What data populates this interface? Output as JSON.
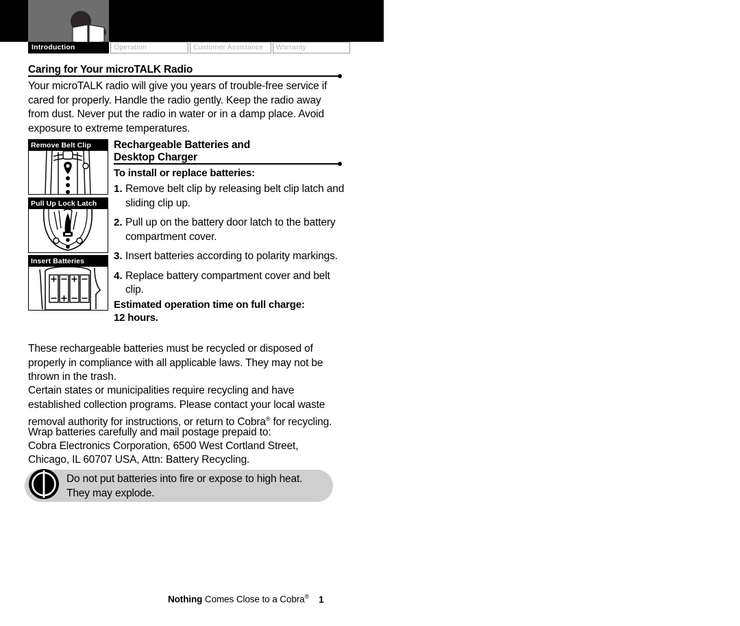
{
  "header": {
    "logo_name": "cobra-open-book-logo",
    "band_color": "#000000",
    "panel_color": "#6e6e6e"
  },
  "tabs": [
    {
      "label": "Introduction",
      "active": true
    },
    {
      "label": "Operation",
      "active": false
    },
    {
      "label": "Customer Assistance",
      "active": false
    },
    {
      "label": "Warranty",
      "active": false
    }
  ],
  "sections": {
    "caring": {
      "heading": "Caring for Your microTALK Radio",
      "paragraph": "Your microTALK radio will give you years of trouble-free service if cared for properly. Handle the radio gently. Keep the radio away from dust. Never put the radio in water or in a damp place. Avoid exposure to extreme temperatures."
    },
    "rechargeable": {
      "heading_line1": "Rechargeable Batteries and",
      "heading_line2": "Desktop Charger",
      "subheading": "To install or replace batteries:",
      "steps": [
        {
          "num": "1.",
          "text": "Remove belt clip by releasing belt clip latch and sliding clip up."
        },
        {
          "num": "2.",
          "text": "Pull up on the battery door latch to the battery compartment cover."
        },
        {
          "num": "3.",
          "text": "Insert batteries according to polarity markings."
        },
        {
          "num": "4.",
          "text": "Replace battery compartment cover and belt clip."
        }
      ],
      "estimate_line1": "Estimated operation time on full charge:",
      "estimate_line2": "12 hours."
    },
    "recycling": {
      "paragraph1": "These rechargeable batteries must be recycled or disposed of properly in compliance with all applicable laws. They may not be thrown in the trash.",
      "paragraph2_pre": "Certain states or municipalities require recycling and have established collection programs. Please contact your local waste removal authority for instructions, or return to Cobra",
      "paragraph2_mark": "®",
      "paragraph2_post": " for recycling.",
      "address_line1": "Wrap batteries carefully and mail postage prepaid to:",
      "address_line2": "Cobra Electronics Corporation, 6500 West Cortland Street,",
      "address_line3": "Chicago, IL 60707 USA, Attn: Battery Recycling."
    },
    "warning": {
      "icon_name": "do-not-burn-icon",
      "line1": "Do not put batteries into fire or expose to high heat.",
      "line2": "They may explode.",
      "background": "#cfcfcf"
    }
  },
  "figures": [
    {
      "caption": "Remove Belt Clip",
      "art": "belt-clip-illustration"
    },
    {
      "caption": "Pull Up Lock Latch",
      "art": "lock-latch-illustration"
    },
    {
      "caption": "Insert Batteries",
      "art": "batteries-illustration"
    }
  ],
  "footer": {
    "bold_word": "Nothing",
    "rest": " Comes Close to a Cobra",
    "mark": "®",
    "page_number": "1"
  }
}
